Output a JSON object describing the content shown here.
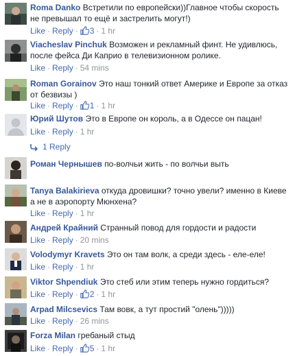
{
  "actions": {
    "like": "Like",
    "reply": "Reply",
    "separator": "·"
  },
  "colors": {
    "author": "#365899",
    "link": "#4267b2",
    "meta": "#90949c",
    "text": "#1d2129"
  },
  "comments": [
    {
      "author": "Roma Danko",
      "text": "Встретили по европейски))Главное чтобы скорость не превышал то ещё и застрелить могут!)",
      "likes": "3",
      "time": "1 hr",
      "avatar_icon": "avatar-photo-icon"
    },
    {
      "author": "Viacheslav Pinchuk",
      "text": "Возможен и рекламный финт. Не удивлюсь, после фейса Ди Каприо в телевизионном ролике.",
      "likes": "",
      "time": "54 mins",
      "avatar_icon": "avatar-photo-icon"
    },
    {
      "author": "Roman Gorainov",
      "text": "Это наш тонкий ответ Америке и Европе за отказ от безвизы )",
      "likes": "1",
      "time": "1 hr",
      "avatar_icon": "avatar-photo-icon"
    },
    {
      "author": "Юрий Шутов",
      "text": "Это в Европе он король, а в Одессе он пацан!",
      "likes": "",
      "time": "1 hr",
      "avatar_icon": "default-avatar-icon"
    },
    {
      "author": "Роман Чернышев",
      "text": "по-волчьи жить - по волчьи выть",
      "likes": "",
      "time": "",
      "avatar_icon": "avatar-photo-icon"
    },
    {
      "author": "Tanya Balakirieva",
      "text": "откуда дровишки? точно увели? именно в Киеве а не в аэропорту Мюнхена?",
      "likes": "",
      "time": "1 hr",
      "avatar_icon": "avatar-photo-icon"
    },
    {
      "author": "Андрей Крайний",
      "text": "Странный повод для гордости и радости",
      "likes": "",
      "time": "20 mins",
      "avatar_icon": "avatar-photo-icon"
    },
    {
      "author": "Volodymyr Kravets",
      "text": "Это он там волк, а среди здесь - еле-еле!",
      "likes": "",
      "time": "1 hr",
      "avatar_icon": "avatar-photo-icon"
    },
    {
      "author": "Viktor Shpendiuk",
      "text": "Это стеб или этим теперь нужно гордиться?",
      "likes": "2",
      "time": "1 hr",
      "avatar_icon": "avatar-photo-icon"
    },
    {
      "author": "Arpad Milcsevics",
      "text": "Там вовк, а тут простий \"олень\")))))",
      "likes": "",
      "time": "26 mins",
      "avatar_icon": "avatar-photo-icon"
    },
    {
      "author": "Forza Milan",
      "text": "гребаный стыд",
      "likes": "5",
      "time": "1 hr",
      "avatar_icon": "avatar-photo-icon"
    }
  ],
  "replies_link": {
    "label": "1 Reply"
  }
}
